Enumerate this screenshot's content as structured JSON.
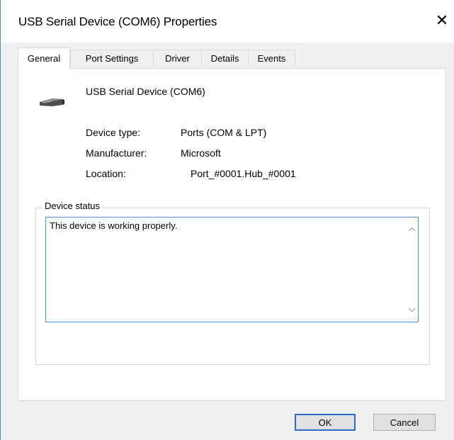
{
  "window": {
    "title": "USB Serial Device (COM6) Properties",
    "close_glyph": "✕"
  },
  "tabs": [
    {
      "label": "General",
      "active": true
    },
    {
      "label": "Port Settings",
      "active": false
    },
    {
      "label": "Driver",
      "active": false
    },
    {
      "label": "Details",
      "active": false
    },
    {
      "label": "Events",
      "active": false
    }
  ],
  "device": {
    "name": "USB Serial Device (COM6)",
    "icon": "serial-port-connector-icon",
    "type_label": "Device type:",
    "type_value": "Ports (COM & LPT)",
    "manufacturer_label": "Manufacturer:",
    "manufacturer_value": "Microsoft",
    "location_label": "Location:",
    "location_value": "Port_#0001.Hub_#0001"
  },
  "status": {
    "group_label": "Device status",
    "text": "This device is working properly."
  },
  "buttons": {
    "ok": "OK",
    "cancel": "Cancel"
  },
  "colors": {
    "focus_border": "#4a8fcf",
    "default_button_border": "#2a6ac8",
    "dialog_bg": "#f0f0f0"
  }
}
